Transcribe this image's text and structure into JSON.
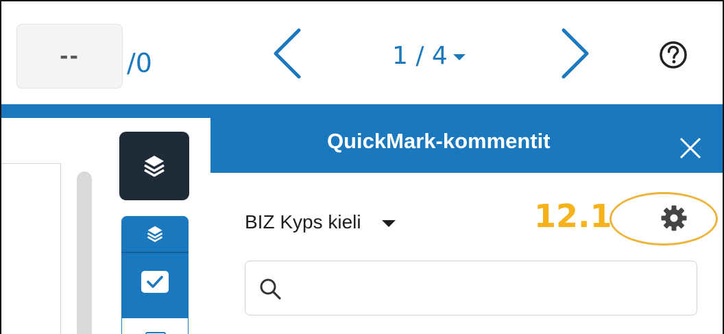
{
  "toolbar": {
    "page_input_value": "--",
    "page_total": "/0",
    "page_selector": "1 / 4",
    "prev_icon": "chevron-left-icon",
    "next_icon": "chevron-right-icon",
    "help_icon": "question-circle-icon"
  },
  "side_tools": {
    "layers_icon": "layers-icon",
    "check_icon": "checkbox-icon"
  },
  "quickmark": {
    "title": "QuickMark-kommentit",
    "set_name": "BIZ Kyps kieli",
    "search_placeholder": "",
    "settings_icon": "gear-icon",
    "close_icon": "close-icon"
  },
  "annotation": {
    "label": "12.1"
  },
  "colors": {
    "primary_blue": "#1a78be",
    "dark_tool": "#1f2b38",
    "annotation_orange": "#f5b21a"
  }
}
